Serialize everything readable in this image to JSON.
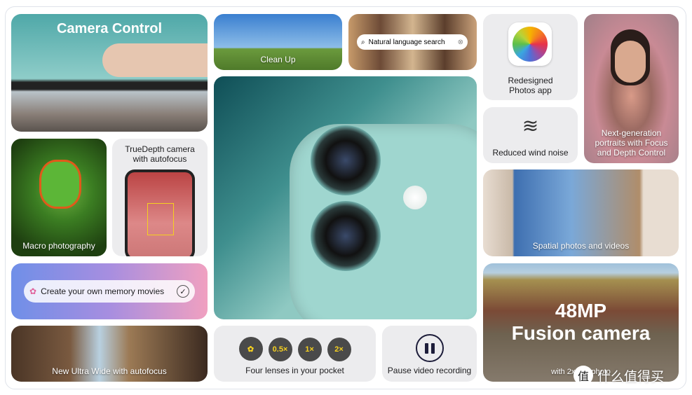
{
  "tiles": {
    "camera_control": "Camera Control",
    "clean_up": "Clean Up",
    "search": {
      "placeholder": "Natural language search"
    },
    "photos_app": "Redesigned Photos app",
    "wind_noise": "Reduced wind noise",
    "portraits": "Next-generation portraits with Focus and Depth Control",
    "macro": "Macro photography",
    "truedepth": "TrueDepth camera with autofocus",
    "spatial": "Spatial photos and videos",
    "memory": "Create your own memory movies",
    "fusion_title_1": "48MP",
    "fusion_title_2": "Fusion camera",
    "fusion_sub": "with 2x Telephoto",
    "ultra_wide": "New Ultra Wide with autofocus",
    "lenses": {
      "label": "Four lenses in your pocket",
      "items": [
        "0.5×",
        "1×",
        "2×"
      ]
    },
    "pause": "Pause video recording"
  },
  "watermark": "什么值得买",
  "colors": {
    "lens_yellow": "#f5d020",
    "phone_teal": "#8fc9c2"
  }
}
